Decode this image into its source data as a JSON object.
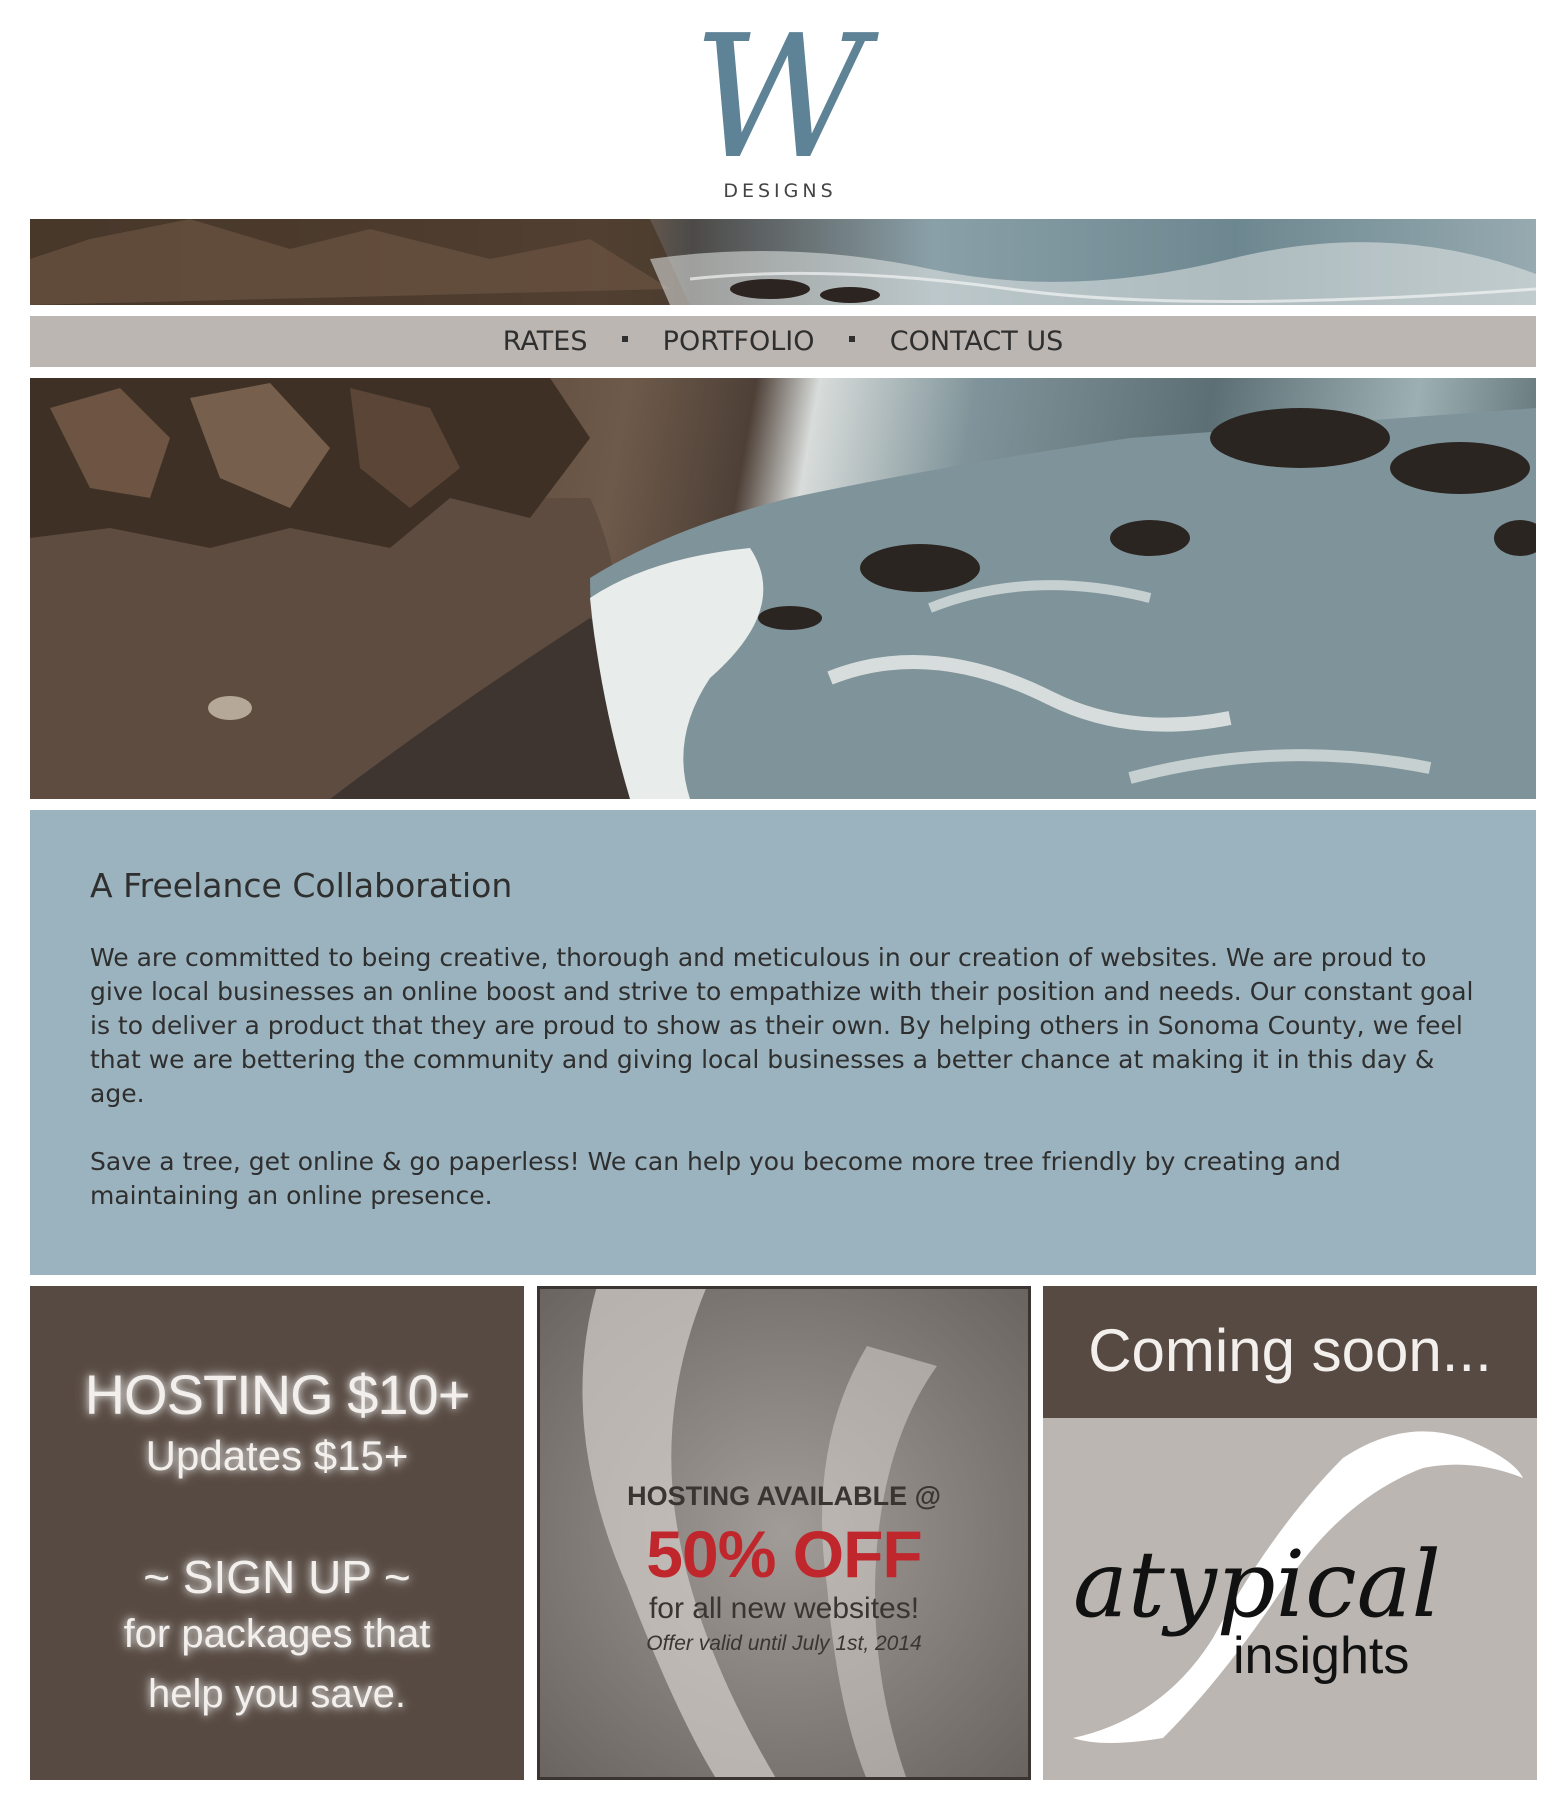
{
  "brand": {
    "logo_letter": "W",
    "logo_text": "DESIGNS"
  },
  "nav": {
    "items": [
      "RATES",
      "PORTFOLIO",
      "CONTACT US"
    ]
  },
  "content": {
    "heading": "A Freelance Collaboration",
    "paragraphs": [
      "We are committed to being creative, thorough and meticulous in our creation of websites. We are proud to give local businesses an online boost and strive to empathize with their position and needs. Our constant goal is to deliver a product that they are proud to show as their own. By helping others in Sonoma County, we feel that we are bettering the community and giving local businesses a better chance at making it in this day & age.",
      "Save a tree, get online & go paperless! We can help you become more tree friendly by creating and maintaining an online presence."
    ]
  },
  "panels": {
    "hosting": {
      "line1": "HOSTING $10+",
      "line2": "Updates $15+",
      "line3": "~ SIGN UP ~",
      "line4": "for packages that",
      "line5": "help you save."
    },
    "promo": {
      "line1": "HOSTING AVAILABLE @",
      "line2": "50% OFF",
      "line3": "for all new websites!",
      "line4": "Offer valid until July 1st, 2014"
    },
    "coming": {
      "title": "Coming soon...",
      "script": "atypical",
      "sub": "insights"
    }
  },
  "colors": {
    "logo_blue": "#5e8296",
    "nav_bg": "#bbb6b1",
    "content_bg": "#9bb3be",
    "panel_brown": "#574a42",
    "promo_red": "#c0272d"
  }
}
